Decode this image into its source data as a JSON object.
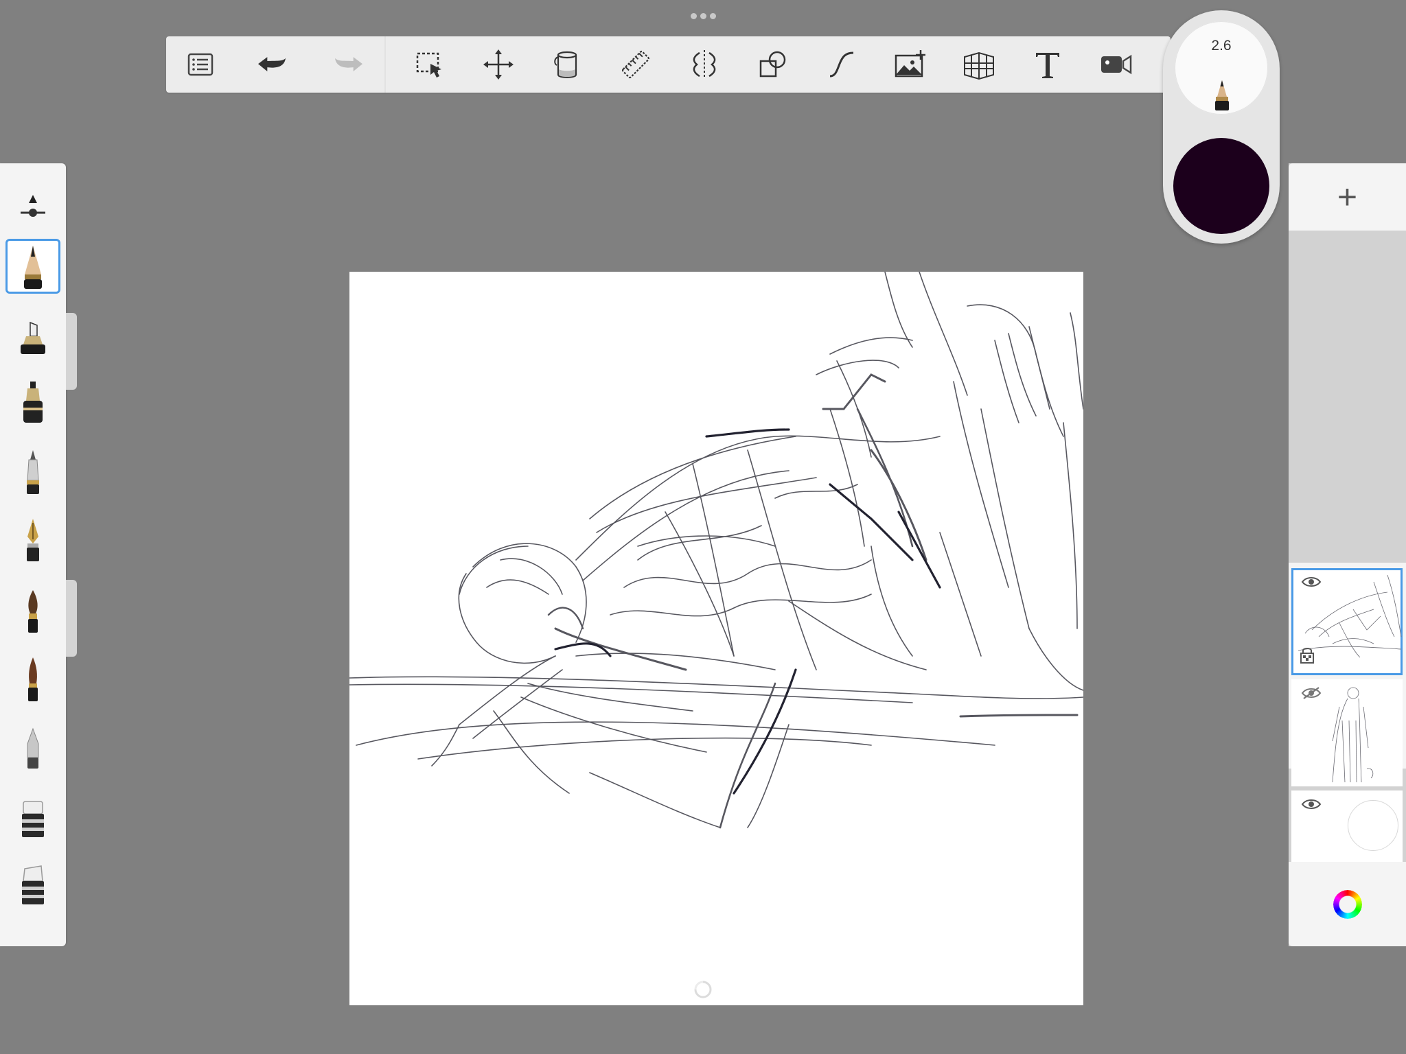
{
  "app": {
    "handle_label": "more-options"
  },
  "toolbar": {
    "left": [
      {
        "name": "menu-list-icon"
      },
      {
        "name": "undo-icon"
      },
      {
        "name": "redo-icon"
      }
    ],
    "tools": [
      {
        "name": "selection-icon"
      },
      {
        "name": "transform-icon"
      },
      {
        "name": "fill-bucket-icon"
      },
      {
        "name": "ruler-icon"
      },
      {
        "name": "symmetry-icon"
      },
      {
        "name": "shapes-icon"
      },
      {
        "name": "stroke-curve-icon"
      },
      {
        "name": "add-image-icon"
      },
      {
        "name": "perspective-grid-icon"
      },
      {
        "name": "text-icon"
      },
      {
        "name": "record-video-icon"
      }
    ]
  },
  "brush_puck": {
    "size_value": "2.6",
    "current_color": "#1c001c"
  },
  "brushes": {
    "selected_index": 1,
    "items": [
      {
        "name": "brush-properties-icon"
      },
      {
        "name": "pencil-brush-icon"
      },
      {
        "name": "marker-brush-icon"
      },
      {
        "name": "airbrush-brush-icon"
      },
      {
        "name": "ballpoint-brush-icon"
      },
      {
        "name": "fountain-pen-brush-icon"
      },
      {
        "name": "paint-brush-icon"
      },
      {
        "name": "ink-brush-icon"
      },
      {
        "name": "smudge-brush-icon"
      },
      {
        "name": "eraser-brush-icon"
      },
      {
        "name": "soft-eraser-brush-icon"
      }
    ]
  },
  "layers": {
    "add_label": "+",
    "items": [
      {
        "name": "layer-1",
        "visible": true,
        "selected": true,
        "locked_transparency": true
      },
      {
        "name": "layer-2",
        "visible": false,
        "selected": false
      },
      {
        "name": "background-layer",
        "visible": true,
        "selected": false
      }
    ]
  },
  "colors": {
    "accent": "#4a9ae6",
    "canvas_background": "#808080",
    "panel": "#f4f4f4",
    "sketch_stroke": "#3a3a44"
  }
}
